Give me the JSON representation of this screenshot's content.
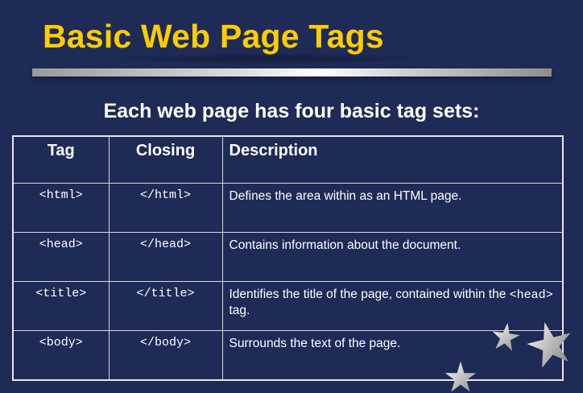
{
  "slide": {
    "title": "Basic Web Page Tags",
    "subtitle": "Each web page has four basic tag sets:"
  },
  "table": {
    "headers": {
      "tag": "Tag",
      "closing": "Closing",
      "description": "Description"
    },
    "rows": [
      {
        "tag": "<html>",
        "closing": "</html>",
        "description": "Defines the area within as an HTML page.",
        "description_code": "",
        "description_tail": ""
      },
      {
        "tag": "<head>",
        "closing": "</head>",
        "description": "Contains information about the document.",
        "description_code": "",
        "description_tail": ""
      },
      {
        "tag": "<title>",
        "closing": "</title>",
        "description": "Identifies the title of the page, contained within the ",
        "description_code": "<head>",
        "description_tail": " tag."
      },
      {
        "tag": "<body>",
        "closing": "</body>",
        "description": "Surrounds the text of the page.",
        "description_code": "",
        "description_tail": ""
      }
    ]
  },
  "colors": {
    "background": "#1e2b57",
    "title": "#ffcc00",
    "text": "#ffffff"
  },
  "decorations": [
    "star-icon",
    "star-icon",
    "star-icon"
  ]
}
